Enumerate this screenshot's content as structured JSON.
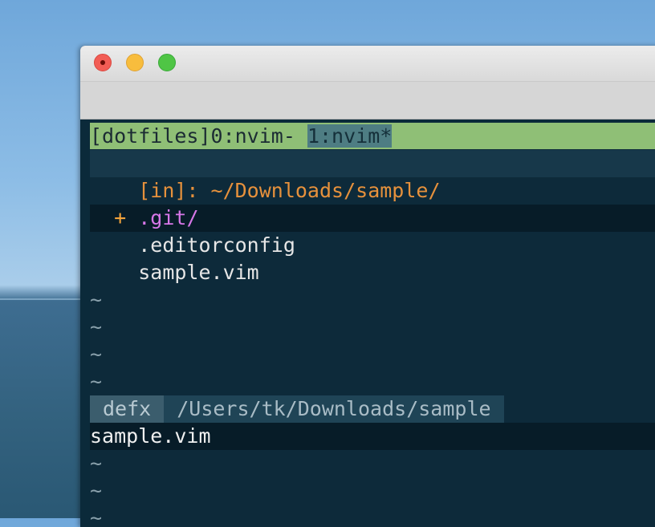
{
  "tmux": {
    "session": "[dotfiles]",
    "window0": "0:nvim-",
    "window1": "1:nvim*"
  },
  "defx": {
    "header": "[in]: ~/Downloads/sample/",
    "items": [
      {
        "marker": "+",
        "name": ".git/"
      },
      {
        "marker": "",
        "name": ".editorconfig"
      },
      {
        "marker": "",
        "name": "sample.vim"
      }
    ],
    "tilde": "~"
  },
  "statusline": {
    "mode": "defx",
    "cwd": "/Users/tk/Downloads/sample"
  },
  "lower_buffer": {
    "current_line": "sample.vim",
    "tilde": "~"
  },
  "colors": {
    "tmux_bar": "#8fbf76",
    "background": "#0d2a3a",
    "path": "#e6913c",
    "directory": "#d777e8"
  }
}
